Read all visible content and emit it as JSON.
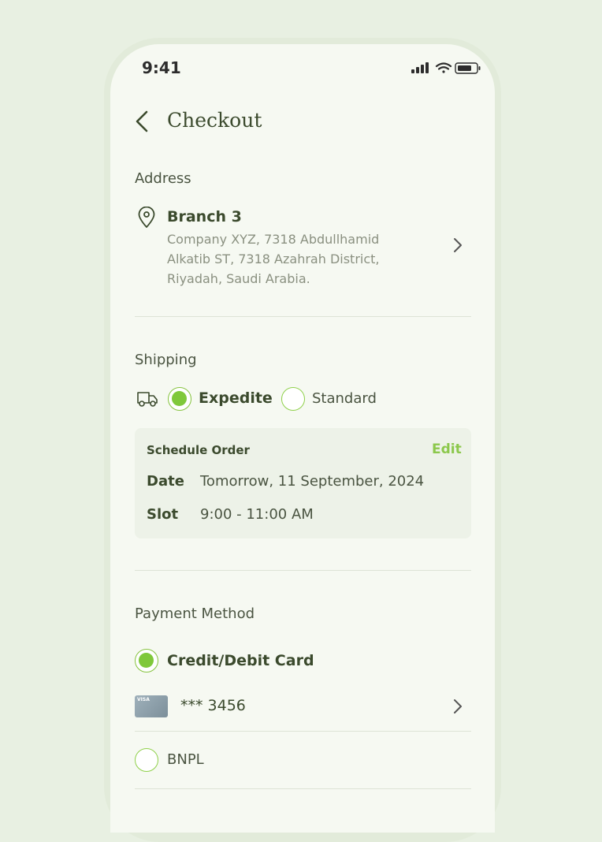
{
  "status_bar": {
    "time": "9:41"
  },
  "header": {
    "title": "Checkout"
  },
  "address": {
    "section_label": "Address",
    "name": "Branch 3",
    "lines": [
      "Company XYZ, 7318 Abdullhamid",
      "Alkatib ST,  7318 Azahrah District,",
      "Riyadah, Saudi Arabia."
    ]
  },
  "shipping": {
    "section_label": "Shipping",
    "option_selected": "Expedite",
    "option_other": "Standard",
    "schedule": {
      "title": "Schedule Order",
      "edit_label": "Edit",
      "date_key": "Date",
      "date_value": "Tomorrow, 11 September, 2024",
      "slot_key": "Slot",
      "slot_value": "9:00 - 11:00 AM"
    }
  },
  "payment": {
    "section_label": "Payment Method",
    "card_option": "Credit/Debit Card",
    "card_brand": "VISA",
    "card_masked": "*** 3456",
    "bnpl_option": "BNPL"
  },
  "colors": {
    "accent": "#7fc83a",
    "background": "#e8f0e2",
    "screen": "#f6f9f2"
  }
}
